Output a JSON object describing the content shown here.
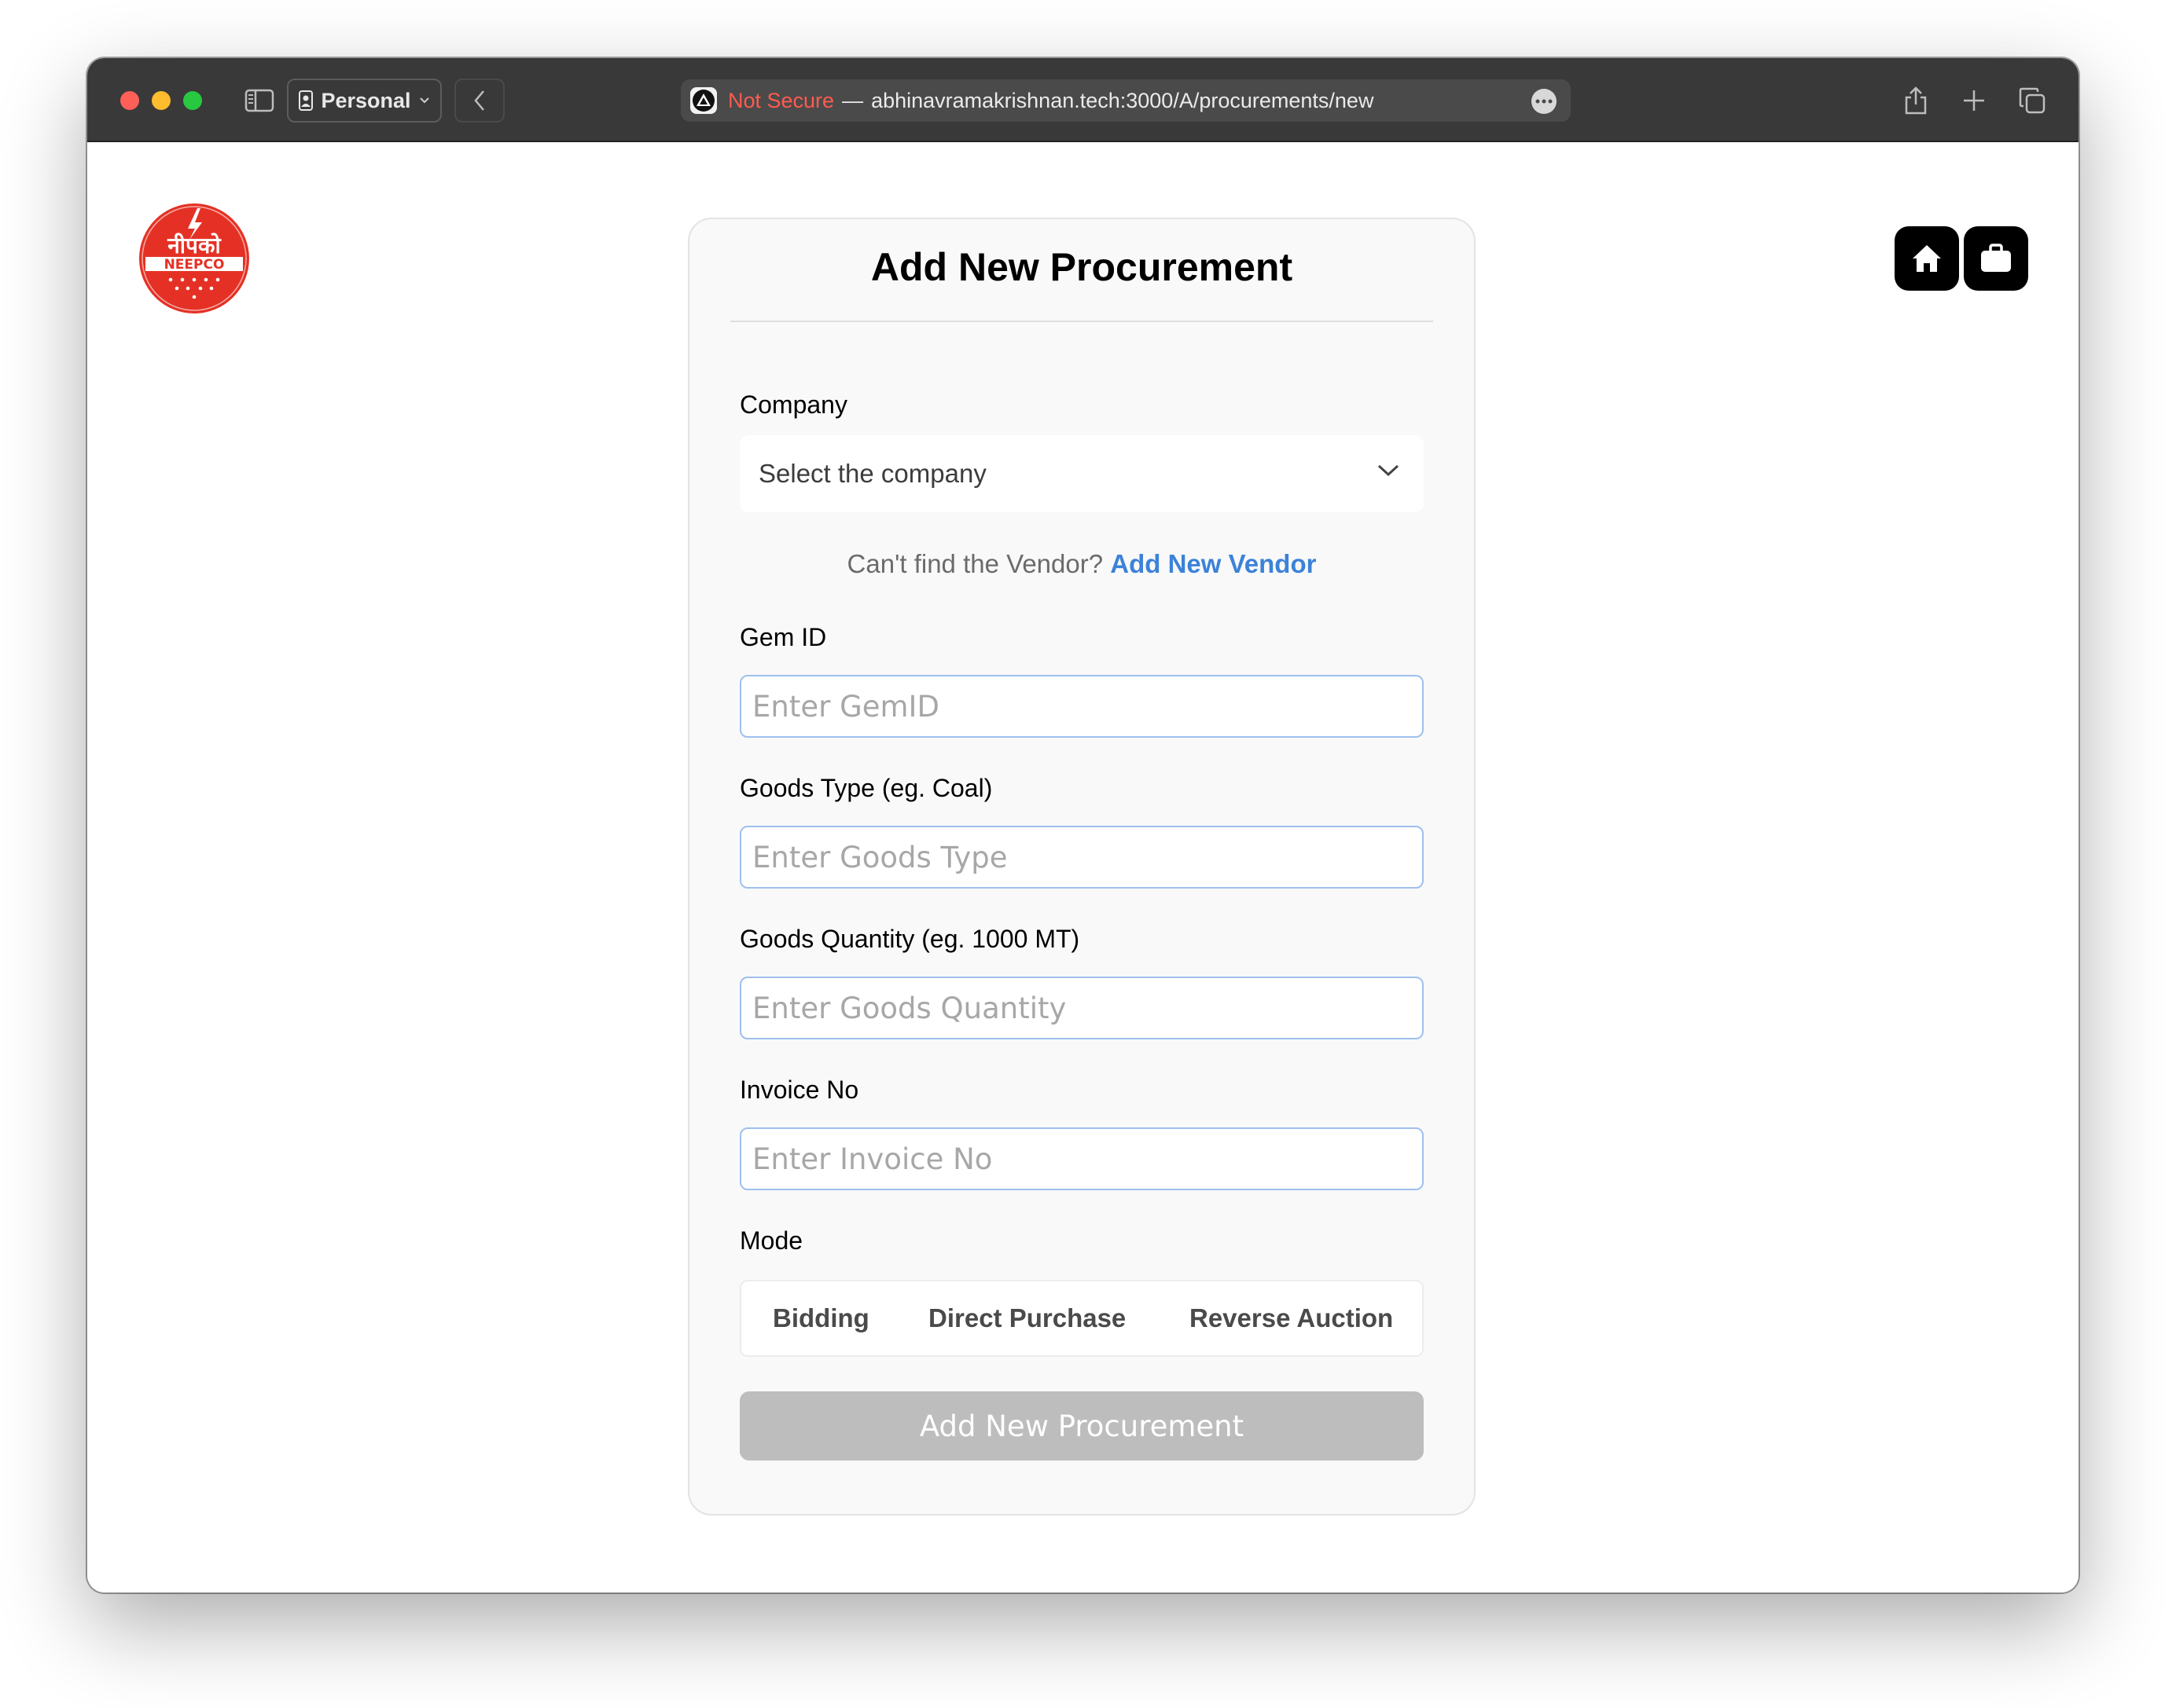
{
  "browser": {
    "profile_label": "Personal",
    "security_label": "Not Secure",
    "separator": "—",
    "url": "abhinavramakrishnan.tech:3000/A/procurements/new"
  },
  "logo": {
    "hindi_text": "नीपको",
    "brand_text": "NEEPCO",
    "colors": {
      "primary": "#e53125",
      "text": "#ffffff"
    }
  },
  "nav": {
    "home_icon": "home-icon",
    "jobs_icon": "briefcase-icon"
  },
  "form": {
    "title": "Add New Procurement",
    "company": {
      "label": "Company",
      "selected": "Select the company"
    },
    "vendor_prompt": {
      "text": "Can't find the Vendor?",
      "link": "Add New Vendor"
    },
    "gem_id": {
      "label": "Gem ID",
      "placeholder": "Enter GemID"
    },
    "goods_type": {
      "label": "Goods Type (eg. Coal)",
      "placeholder": "Enter Goods Type"
    },
    "goods_quantity": {
      "label": "Goods Quantity (eg. 1000 MT)",
      "placeholder": "Enter Goods Quantity"
    },
    "invoice_no": {
      "label": "Invoice No",
      "placeholder": "Enter Invoice No"
    },
    "mode": {
      "label": "Mode",
      "options": [
        "Bidding",
        "Direct Purchase",
        "Reverse Auction"
      ]
    },
    "submit_label": "Add New Procurement"
  },
  "colors": {
    "link": "#3c82d8",
    "input_border": "#9ec0ee",
    "submit_disabled": "#bdbdbd",
    "titlebar": "#393939"
  }
}
